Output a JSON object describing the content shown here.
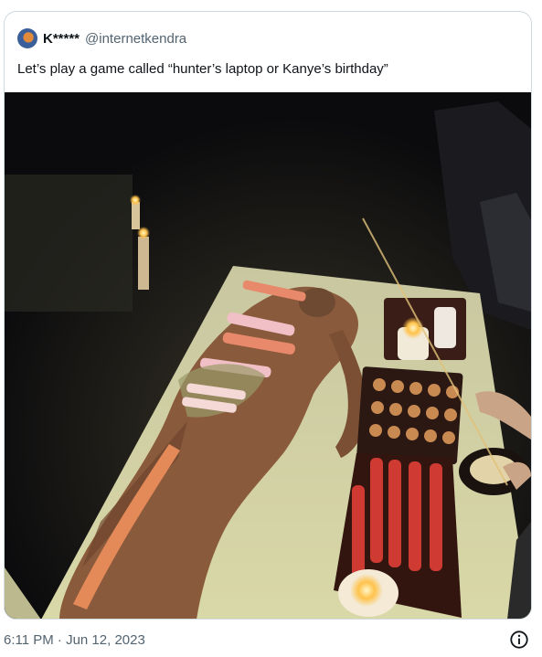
{
  "quoted_tweet": {
    "display_name": "K*****",
    "handle": "@internetkendra",
    "text": "Let’s play a game called “hunter’s laptop or Kanye’s birthday”",
    "avatar_icon": "avatar-image",
    "media": {
      "kind": "photo"
    }
  },
  "tweet": {
    "timestamp": "6:11 PM · Jun 12, 2023",
    "info_icon": "info-icon"
  },
  "colors": {
    "border": "#cfd9de",
    "text_primary": "#0f1419",
    "text_secondary": "#536471"
  }
}
